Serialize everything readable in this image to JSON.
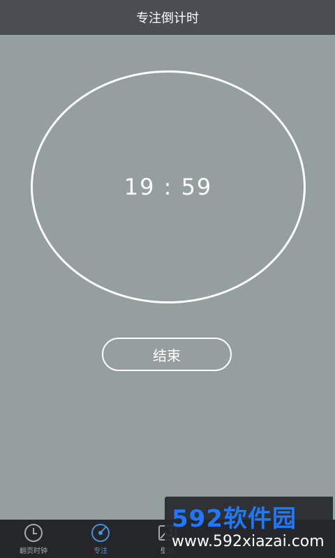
{
  "header": {
    "title": "专注倒计时"
  },
  "timer": {
    "display": "19 : 59"
  },
  "actions": {
    "end_label": "结束"
  },
  "tabbar": {
    "tabs": [
      {
        "label": "翻页时钟",
        "icon": "clock-icon",
        "active": false
      },
      {
        "label": "专注",
        "icon": "focus-icon",
        "active": true
      },
      {
        "label": "壁纸",
        "icon": "wallpaper-icon",
        "active": false
      }
    ]
  },
  "watermark": {
    "logo": "592软件园",
    "url": "www.592xiazai.com"
  },
  "colors": {
    "background": "#949f9e",
    "header": "#4a4d51",
    "tabbar": "#242628",
    "accent": "#4a90e2"
  }
}
